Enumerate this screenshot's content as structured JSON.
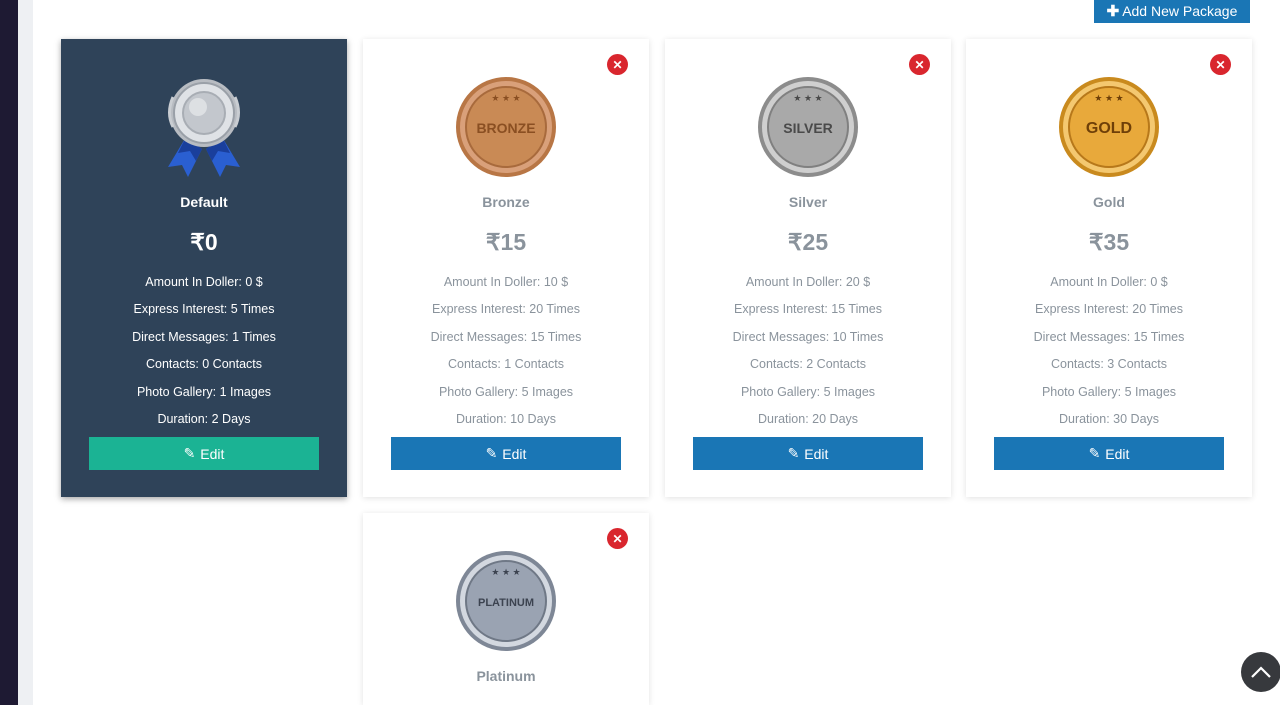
{
  "header": {
    "add_button_label": "Add New Package"
  },
  "edit_label": "Edit",
  "packages": [
    {
      "name": "Default",
      "price": "₹0",
      "features": [
        "Amount In Doller: 0 $",
        "Express Interest: 5 Times",
        "Direct Messages: 1 Times",
        "Contacts: 0 Contacts",
        "Photo Gallery: 1 Images",
        "Duration: 2 Days"
      ]
    },
    {
      "name": "Bronze",
      "price": "₹15",
      "badge_text": "BRONZE",
      "features": [
        "Amount In Doller: 10 $",
        "Express Interest: 20 Times",
        "Direct Messages: 15 Times",
        "Contacts: 1 Contacts",
        "Photo Gallery: 5 Images",
        "Duration: 10 Days"
      ]
    },
    {
      "name": "Silver",
      "price": "₹25",
      "badge_text": "SILVER",
      "features": [
        "Amount In Doller: 20 $",
        "Express Interest: 15 Times",
        "Direct Messages: 10 Times",
        "Contacts: 2 Contacts",
        "Photo Gallery: 5 Images",
        "Duration: 20 Days"
      ]
    },
    {
      "name": "Gold",
      "price": "₹35",
      "badge_text": "GOLD",
      "features": [
        "Amount In Doller: 0 $",
        "Express Interest: 20 Times",
        "Direct Messages: 15 Times",
        "Contacts: 3 Contacts",
        "Photo Gallery: 5 Images",
        "Duration: 30 Days"
      ]
    },
    {
      "name": "Platinum",
      "badge_text": "PLATINUM"
    }
  ],
  "icons": {
    "close": "close-icon",
    "edit": "edit-icon",
    "add": "plus-icon",
    "scroll_top": "chevron-up-icon"
  },
  "colors": {
    "primary": "#1a76b5",
    "success": "#1bb394",
    "danger": "#d9262e",
    "dark_card": "#2f4359",
    "bronze": "#c98a55",
    "silver": "#a9a9a9",
    "gold": "#e8a93b",
    "platinum": "#9aa3b2"
  }
}
